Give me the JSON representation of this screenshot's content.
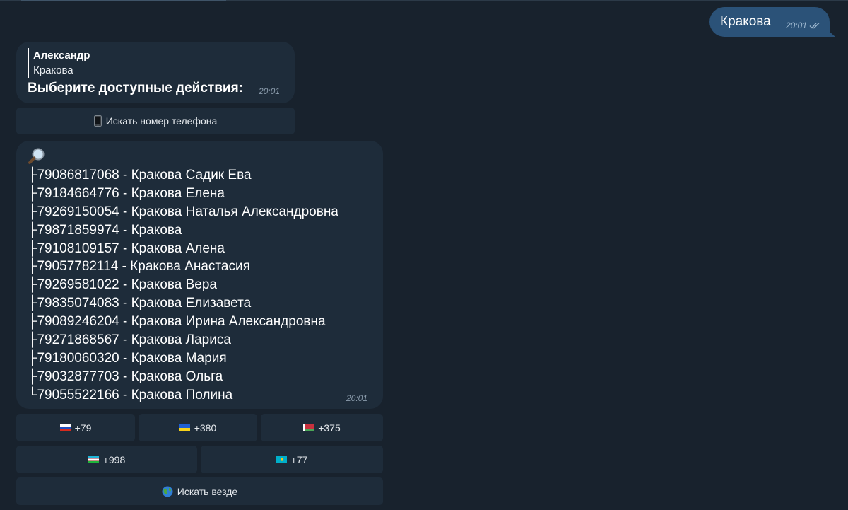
{
  "outgoing": {
    "text": "Кракова",
    "time": "20:01",
    "status_icon": "double-check-icon"
  },
  "bot_message": {
    "reply_author": "Александр",
    "reply_text": "Кракова",
    "text": "Выберите доступные действия:",
    "time": "20:01"
  },
  "action_button": {
    "icon": "phone-icon",
    "label": "Искать номер телефона"
  },
  "results_message": {
    "icon": "magnifier-icon",
    "items": [
      {
        "prefix": "├",
        "text": "79086817068 - Кракова Садик Ева"
      },
      {
        "prefix": "├",
        "text": "79184664776 - Кракова Елена"
      },
      {
        "prefix": "├",
        "text": "79269150054 - Кракова Наталья Александровна"
      },
      {
        "prefix": "├",
        "text": "79871859974 - Кракова"
      },
      {
        "prefix": "├",
        "text": "79108109157 - Кракова Алена"
      },
      {
        "prefix": "├",
        "text": "79057782114 - Кракова Анастасия"
      },
      {
        "prefix": "├",
        "text": "79269581022 - Кракова Вера"
      },
      {
        "prefix": "├",
        "text": "79835074083 - Кракова Елизавета"
      },
      {
        "prefix": "├",
        "text": "79089246204 - Кракова Ирина Александровна"
      },
      {
        "prefix": "├",
        "text": "79271868567 - Кракова Лариса"
      },
      {
        "prefix": "├",
        "text": "79180060320 - Кракова Мария"
      },
      {
        "prefix": "├",
        "text": "79032877703 - Кракова Ольга"
      },
      {
        "prefix": "└",
        "text": "79055522166 - Кракова Полина"
      }
    ],
    "time": "20:01"
  },
  "country_buttons": [
    {
      "label": "+79",
      "icon": "russia-flag-icon"
    },
    {
      "label": "+380",
      "icon": "ukraine-flag-icon"
    },
    {
      "label": "+375",
      "icon": "belarus-flag-icon"
    },
    {
      "label": "+998",
      "icon": "uzbekistan-flag-icon"
    },
    {
      "label": "+77",
      "icon": "kazakhstan-flag-icon"
    }
  ],
  "search_everywhere": {
    "icon": "globe-icon",
    "label": "Искать везде"
  },
  "colors": {
    "background": "#18222d",
    "incoming_bubble": "#1e2c3a",
    "outgoing_bubble": "#2b5278"
  }
}
